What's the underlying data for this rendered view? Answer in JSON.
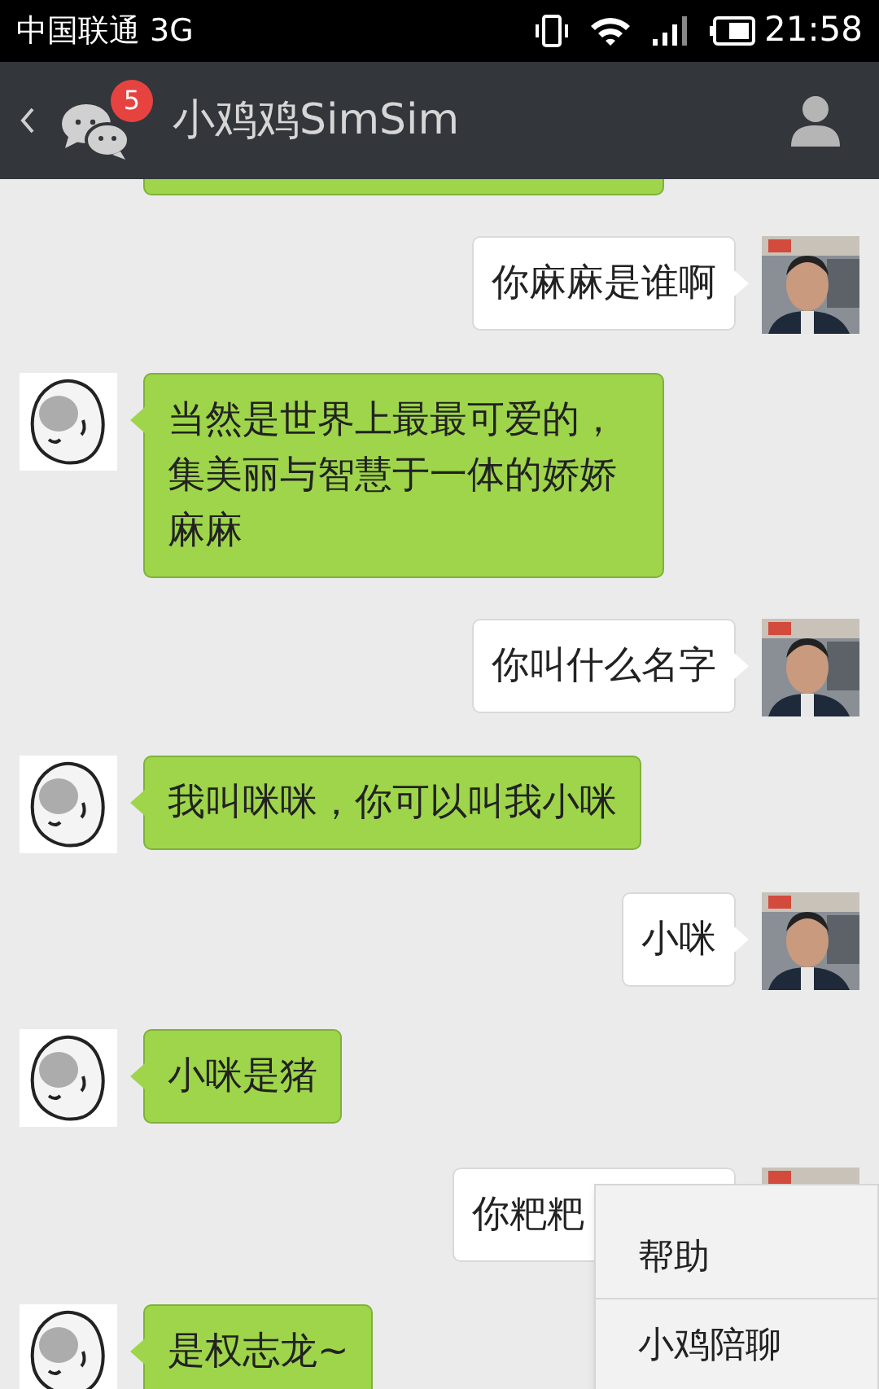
{
  "status_bar": {
    "carrier": "中国联通 3G",
    "time": "21:58"
  },
  "header": {
    "unread_badge": "5",
    "title": "小鸡鸡SimSim"
  },
  "messages": [
    {
      "kind": "incoming",
      "cut": true
    },
    {
      "kind": "outgoing",
      "text": "你麻麻是谁啊"
    },
    {
      "kind": "incoming",
      "text": "当然是世界上最最可爱的，集美丽与智慧于一体的娇娇麻麻"
    },
    {
      "kind": "outgoing",
      "text": "你叫什么名字"
    },
    {
      "kind": "incoming",
      "text": "我叫咪咪，你可以叫我小咪"
    },
    {
      "kind": "outgoing",
      "text": "小咪"
    },
    {
      "kind": "incoming",
      "text": "小咪是猪"
    },
    {
      "kind": "outgoing",
      "text": "你粑粑",
      "wide": true
    },
    {
      "kind": "incoming",
      "text": "是权志龙~"
    }
  ],
  "popup_menu": {
    "items": [
      "帮助",
      "小鸡陪聊"
    ]
  }
}
